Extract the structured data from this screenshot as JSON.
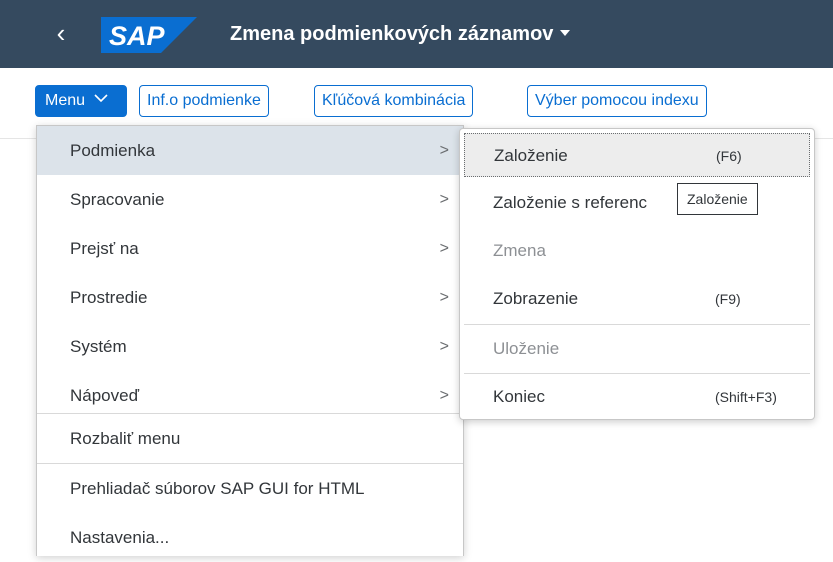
{
  "shell": {
    "back_icon": "chevron-left-icon",
    "logo_text": "SAP",
    "title": "Zmena podmienkových záznamov",
    "title_icon": "caret-down-icon",
    "colors": {
      "shell_bg": "#354a5f",
      "logo_blue": "#0a6ed1",
      "text": "#ffffff"
    }
  },
  "toolbar": {
    "menu_label": "Menu",
    "menu_icon": "chevron-down-icon",
    "buttons": [
      "Inf.o podmienke",
      "Kľúčová kombinácia",
      "Výber pomocou indexu"
    ],
    "accent": "#0a6ed1"
  },
  "menu": {
    "items": [
      {
        "label": "Podmienka",
        "has_submenu": true,
        "highlighted": true
      },
      {
        "label": "Spracovanie",
        "has_submenu": true
      },
      {
        "label": "Prejsť na",
        "has_submenu": true
      },
      {
        "label": "Prostredie",
        "has_submenu": true
      },
      {
        "label": "Systém",
        "has_submenu": true
      },
      {
        "label": "Nápoveď",
        "has_submenu": true
      },
      {
        "label": "Rozbaliť menu"
      },
      {
        "label": "Prehliadač súborov SAP GUI for HTML"
      },
      {
        "label": "Nastavenia..."
      }
    ],
    "arrow_glyph": ">"
  },
  "submenu": {
    "items": [
      {
        "label": "Založenie",
        "shortcut": "(F6)",
        "focused": true
      },
      {
        "label": "Založenie s referenc"
      },
      {
        "label": "Zmena",
        "disabled": true
      },
      {
        "label": "Zobrazenie",
        "shortcut": "(F9)"
      },
      {
        "label": "Uloženie",
        "disabled": true
      },
      {
        "label": "Koniec",
        "shortcut": "(Shift+F3)"
      }
    ]
  },
  "tooltip": {
    "text": "Založenie"
  }
}
